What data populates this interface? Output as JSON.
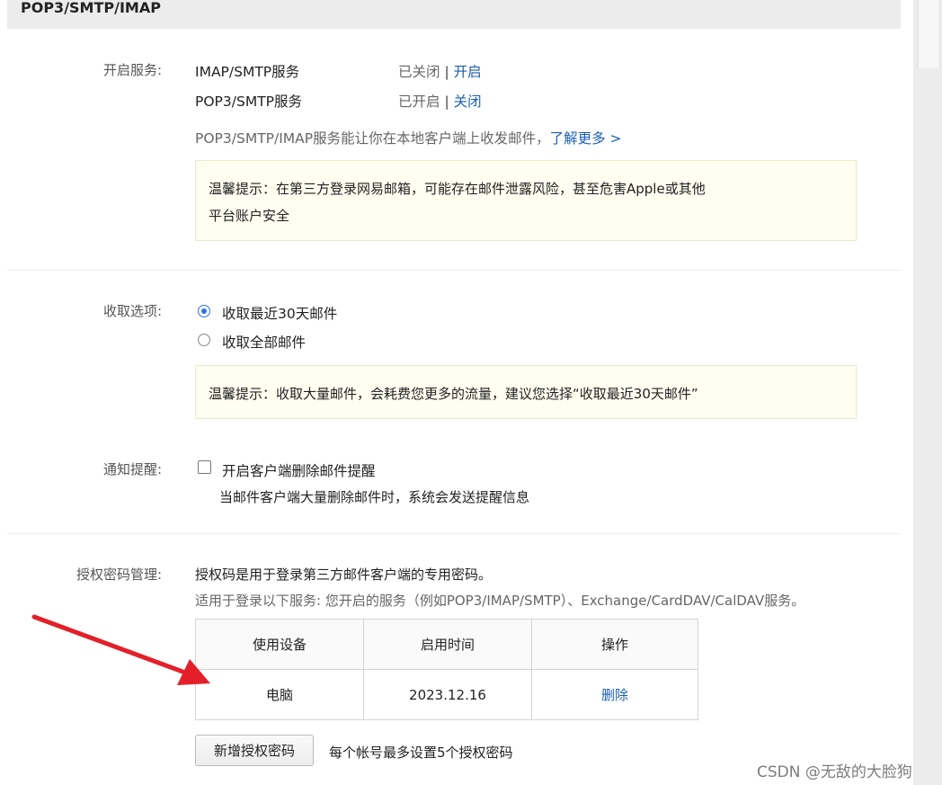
{
  "header": {
    "title": "POP3/SMTP/IMAP"
  },
  "services": {
    "label": "开启服务:",
    "items": [
      {
        "name": "IMAP/SMTP服务",
        "status": "已关闭",
        "action": "开启"
      },
      {
        "name": "POP3/SMTP服务",
        "status": "已开启",
        "action": "关闭"
      }
    ],
    "description": "POP3/SMTP/IMAP服务能让你在本地客户端上收发邮件，",
    "learn_more": "了解更多 >",
    "tip_line1": "温馨提示：在第三方登录网易邮箱，可能存在邮件泄露风险，甚至危害Apple或其他",
    "tip_line2": "平台账户安全"
  },
  "fetch": {
    "label": "收取选项:",
    "options": [
      {
        "label": "收取最近30天邮件",
        "selected": true
      },
      {
        "label": "收取全部邮件",
        "selected": false
      }
    ],
    "tip": "温馨提示：收取大量邮件，会耗费您更多的流量，建议您选择“收取最近30天邮件”"
  },
  "notify": {
    "label": "通知提醒:",
    "checkbox_label": "开启客户端删除邮件提醒",
    "checked": false,
    "hint": "当邮件客户端大量删除邮件时，系统会发送提醒信息"
  },
  "auth": {
    "label": "授权密码管理:",
    "desc1": "授权码是用于登录第三方邮件客户端的专用密码。",
    "desc2": "适用于登录以下服务: 您开启的服务（例如POP3/IMAP/SMTP）、Exchange/CardDAV/CalDAV服务。",
    "table": {
      "headers": [
        "使用设备",
        "启用时间",
        "操作"
      ],
      "rows": [
        {
          "device": "电脑",
          "date": "2023.12.16",
          "action": "删除"
        }
      ]
    },
    "add_button": "新增授权密码",
    "limit_note": "每个帐号最多设置5个授权密码"
  },
  "watermark": "CSDN @无敌的大脸狗",
  "colors": {
    "link": "#1a5fb4",
    "radio_active": "#2f72e6",
    "annotation_arrow": "#e3202a",
    "tip_bg": "#fffef0"
  }
}
